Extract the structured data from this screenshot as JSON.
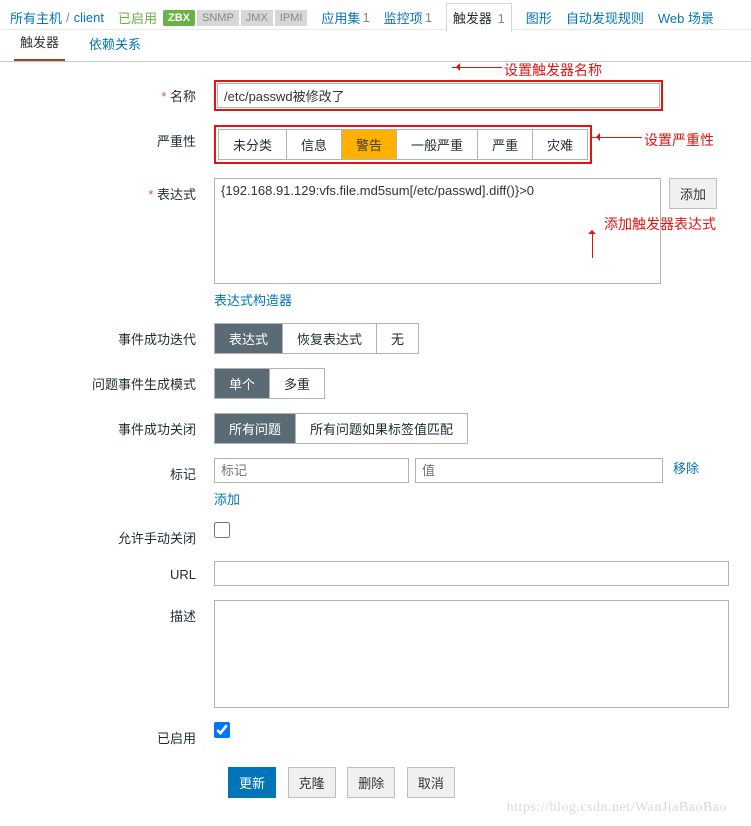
{
  "topbar": {
    "all_hosts": "所有主机",
    "client": "client",
    "enabled": "已启用",
    "zbx": "ZBX",
    "snmp": "SNMP",
    "jmx": "JMX",
    "ipmi": "IPMI",
    "tabs": {
      "apps": "应用集",
      "apps_n": "1",
      "items": "监控项",
      "items_n": "1",
      "triggers": "触发器",
      "triggers_n": "1",
      "graphs": "图形",
      "discovery": "自动发现规则",
      "web": "Web 场景"
    }
  },
  "subtabs": {
    "trigger": "触发器",
    "deps": "依赖关系"
  },
  "labels": {
    "name": "名称",
    "severity": "严重性",
    "expression": "表达式",
    "expr_builder": "表达式构造器",
    "ok_iter": "事件成功迭代",
    "problem_mode": "问题事件生成模式",
    "ok_close": "事件成功关闭",
    "tags": "标记",
    "allow_manual": "允许手动关闭",
    "url": "URL",
    "description": "描述",
    "enabled": "已启用"
  },
  "values": {
    "name": "/etc/passwd被修改了",
    "expression": "{192.168.91.129:vfs.file.md5sum[/etc/passwd].diff()}>0",
    "url": "",
    "description": "",
    "enabled_checked": true
  },
  "severity": {
    "o1": "未分类",
    "o2": "信息",
    "o3": "警告",
    "o4": "一般严重",
    "o5": "严重",
    "o6": "灾难"
  },
  "ok_iter": {
    "o1": "表达式",
    "o2": "恢复表达式",
    "o3": "无"
  },
  "problem_mode": {
    "o1": "单个",
    "o2": "多重"
  },
  "ok_close": {
    "o1": "所有问题",
    "o2": "所有问题如果标签值匹配"
  },
  "tags": {
    "tag_ph": "标记",
    "val_ph": "值",
    "remove": "移除",
    "add": "添加"
  },
  "buttons": {
    "add_expr": "添加",
    "update": "更新",
    "clone": "克隆",
    "delete": "删除",
    "cancel": "取消"
  },
  "annotations": {
    "name": "设置触发器名称",
    "severity": "设置严重性",
    "expr": "添加触发器表达式"
  },
  "watermark": "https://blog.csdn.net/WanJiaBaoBao"
}
